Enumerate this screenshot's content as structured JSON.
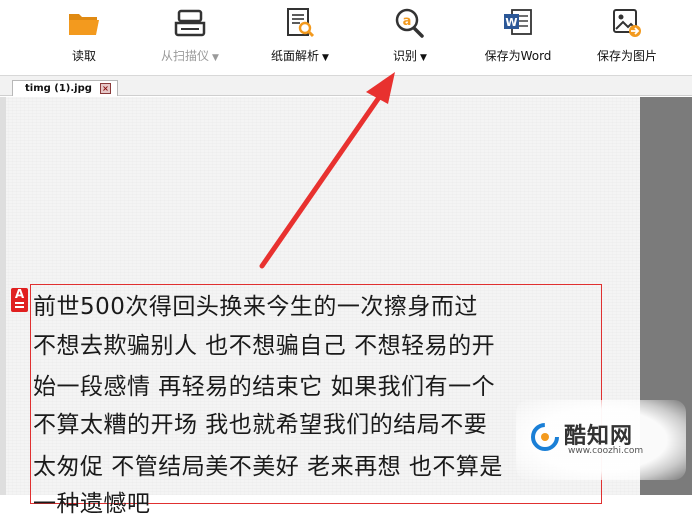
{
  "toolbar": {
    "items": [
      {
        "label": "读取",
        "icon": "folder-open-icon",
        "caret": false,
        "disabled": false
      },
      {
        "label": "从扫描仪",
        "icon": "scanner-icon",
        "caret": true,
        "disabled": true
      },
      {
        "label": "纸面解析",
        "icon": "page-analyze-icon",
        "caret": true,
        "disabled": false
      },
      {
        "label": "识别",
        "icon": "ocr-recognize-icon",
        "caret": true,
        "disabled": false
      },
      {
        "label": "保存为Word",
        "icon": "word-icon",
        "caret": false,
        "disabled": false
      },
      {
        "label": "保存为图片",
        "icon": "save-image-icon",
        "caret": false,
        "disabled": false
      }
    ],
    "caret_glyph": "▼"
  },
  "tab": {
    "label": "timg (1).jpg",
    "close_glyph": "×"
  },
  "region_tag": {
    "letter": "A"
  },
  "ocr_text": {
    "lines": [
      "前世500次得回头换来今生的一次擦身而过",
      " 不想去欺骗别人 也不想骗自己 不想轻易的开",
      "始一段感情 再轻易的结束它 如果我们有一个",
      "不算太糟的开场 我也就希望我们的结局不要",
      "太匆促 不管结局美不美好 老来再想 也不算是",
      "一种遗憾吧"
    ]
  },
  "watermark": {
    "name": "酷知网",
    "url": "www.coozhi.com"
  },
  "colors": {
    "accent_orange": "#f39a1e",
    "arrow_red": "#e8312f",
    "region_red": "#e03030",
    "word_blue": "#2b5797"
  }
}
